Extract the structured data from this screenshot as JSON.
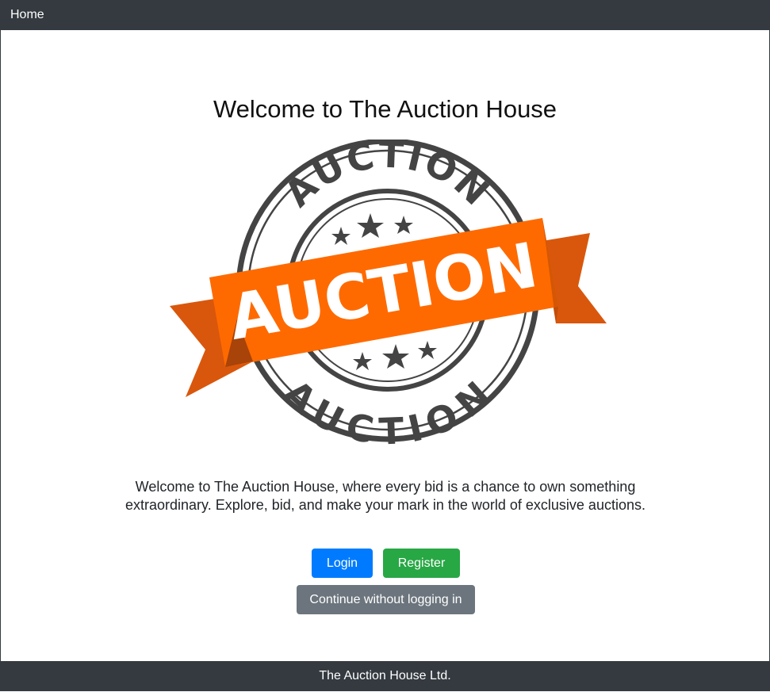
{
  "nav": {
    "home_label": "Home"
  },
  "main": {
    "heading": "Welcome to The Auction House",
    "logo": {
      "ribbon_text": "AUCTION",
      "top_arc_text": "AUCTION",
      "bottom_arc_text": "AUCTION"
    },
    "intro": "Welcome to The Auction House, where every bid is a chance to own something extraordinary. Explore, bid, and make your mark in the world of exclusive auctions."
  },
  "buttons": {
    "login": "Login",
    "register": "Register",
    "continue": "Continue without logging in"
  },
  "footer": {
    "text": "The Auction House Ltd."
  },
  "colors": {
    "nav_bg": "#343a40",
    "login": "#007bff",
    "register": "#28a745",
    "continue": "#6c757d",
    "ribbon": "#ff6a00",
    "ribbon_dark": "#d9570c",
    "stamp": "#444444"
  }
}
